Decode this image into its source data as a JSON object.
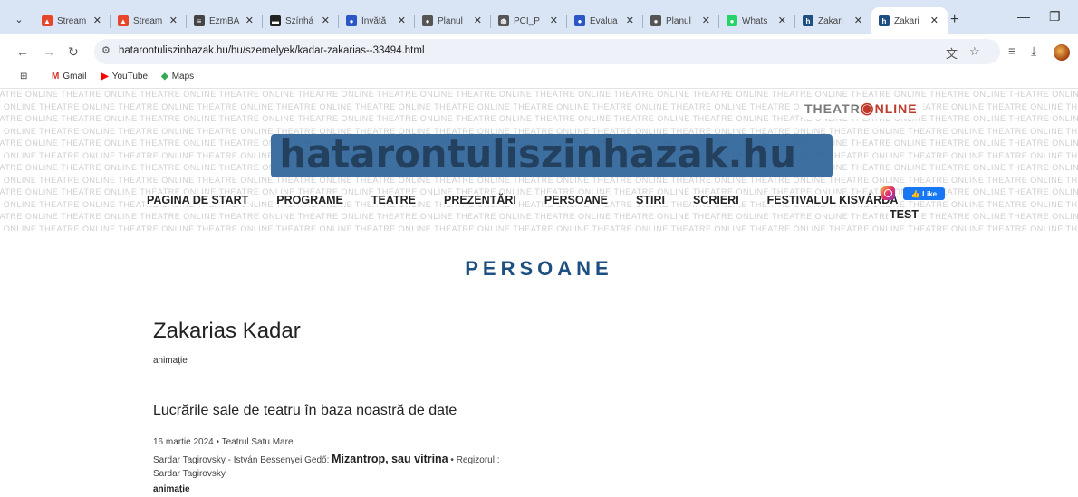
{
  "browser": {
    "tabs": [
      {
        "title": "Stream",
        "favicon_color": "#e8462b",
        "favicon_glyph": "▲"
      },
      {
        "title": "Stream",
        "favicon_color": "#e8462b",
        "favicon_glyph": "▲"
      },
      {
        "title": "EzmBA",
        "favicon_color": "#444444",
        "favicon_glyph": "≡"
      },
      {
        "title": "Színhá",
        "favicon_color": "#222222",
        "favicon_glyph": "▬"
      },
      {
        "title": "Învăță",
        "favicon_color": "#2a56c6",
        "favicon_glyph": "●"
      },
      {
        "title": "Planul",
        "favicon_color": "#555555",
        "favicon_glyph": "●"
      },
      {
        "title": "PCI_P",
        "favicon_color": "#555555",
        "favicon_glyph": "◍"
      },
      {
        "title": "Evalua",
        "favicon_color": "#2a56c6",
        "favicon_glyph": "●"
      },
      {
        "title": "Planul",
        "favicon_color": "#555555",
        "favicon_glyph": "●"
      },
      {
        "title": "Whats",
        "favicon_color": "#25d366",
        "favicon_glyph": "●"
      },
      {
        "title": "Zakari",
        "favicon_color": "#1e4f82",
        "favicon_glyph": "h"
      },
      {
        "title": "Zakari",
        "favicon_color": "#1e4f82",
        "favicon_glyph": "h",
        "active": true
      }
    ],
    "url": "hatarontuliszinhazak.hu/hu/szemelyek/kadar-zakarias--33494.html",
    "bookmarks": [
      {
        "label": "Gmail",
        "icon": "M",
        "color": "#d93025"
      },
      {
        "label": "YouTube",
        "icon": "▶",
        "color": "#ff0000"
      },
      {
        "label": "Maps",
        "icon": "◆",
        "color": "#34a853"
      }
    ]
  },
  "site": {
    "watermark_text": "THEATRE ONLINE",
    "partner_logo": {
      "part1": "THEATR",
      "part2": "NLINE"
    },
    "banner_title": "hatarontuliszinhazak.hu",
    "nav": [
      "PAGINA DE START",
      "PROGRAME",
      "TEATRE",
      "PREZENTĂRI",
      "PERSOANE",
      "ȘTIRI",
      "SCRIERI",
      "FESTIVALUL KISVÁRDA"
    ],
    "nav_extra": "TEST",
    "fb_like": "Like",
    "accent": "#1e4f82"
  },
  "page": {
    "section_title": "PERSOANE",
    "person_name": "Zakarias Kadar",
    "person_role": "animație",
    "works_title": "Lucrările sale de teatru în baza noastră de date",
    "entries": [
      {
        "date_venue": "16 martie 2024 • Teatrul Satu Mare",
        "authors": "Sardar Tagirovsky - István Bessenyei Gedő: ",
        "play": "Mizantrop, sau vitrina",
        "director_label": " • Regizorul :",
        "director": "Sardar Tagirovsky",
        "role": "animație"
      }
    ]
  }
}
